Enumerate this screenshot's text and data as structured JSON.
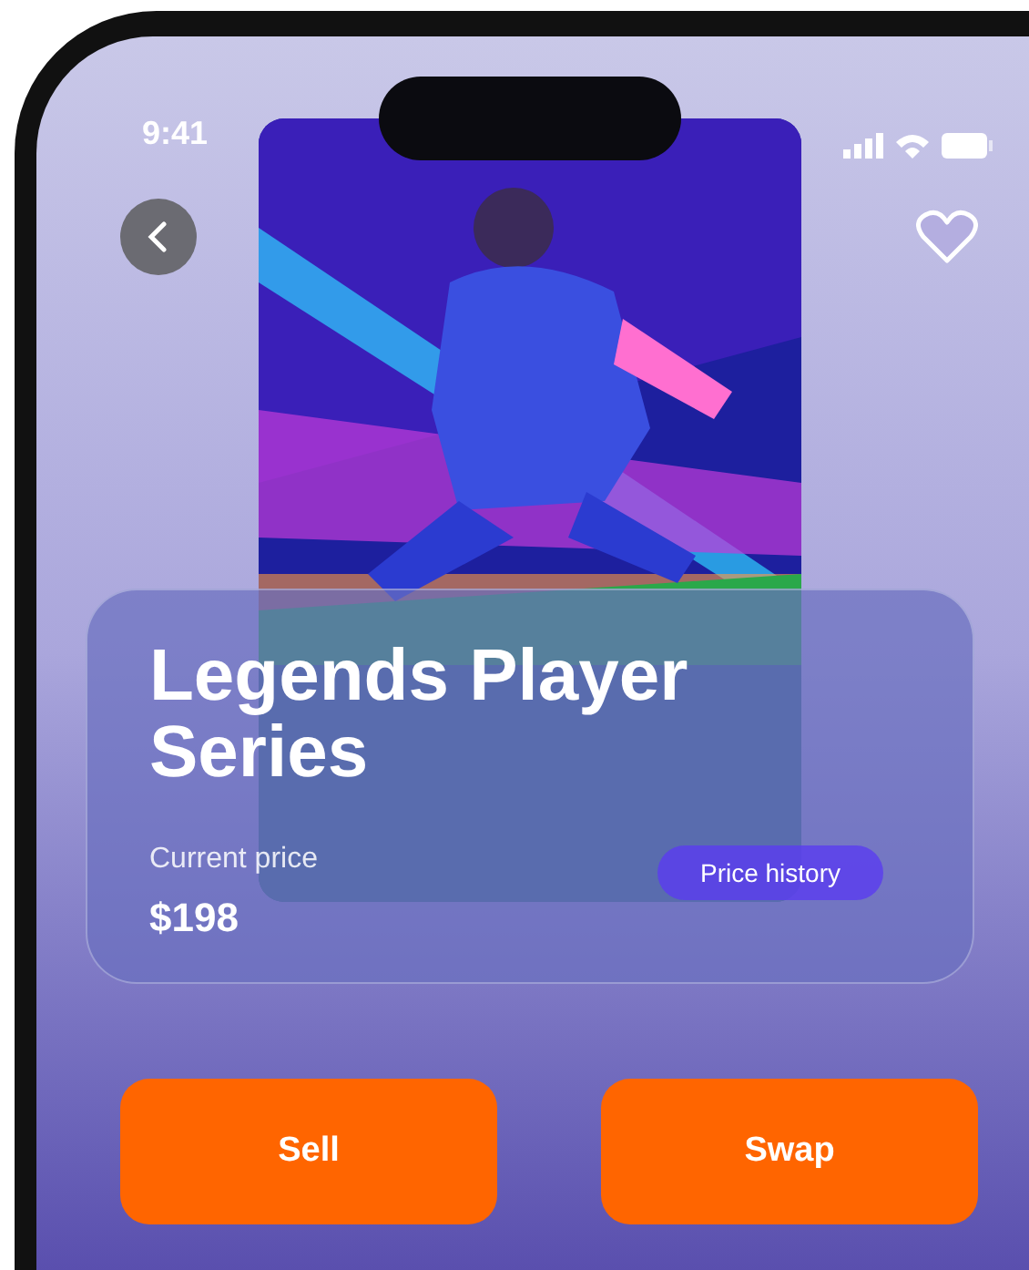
{
  "status_bar": {
    "time": "9:41"
  },
  "product": {
    "title": "Legends Player Series",
    "price_label": "Current price",
    "price": "$198",
    "history_button": "Price history"
  },
  "actions": [
    {
      "label": "Sell"
    },
    {
      "label": "Swap"
    }
  ]
}
